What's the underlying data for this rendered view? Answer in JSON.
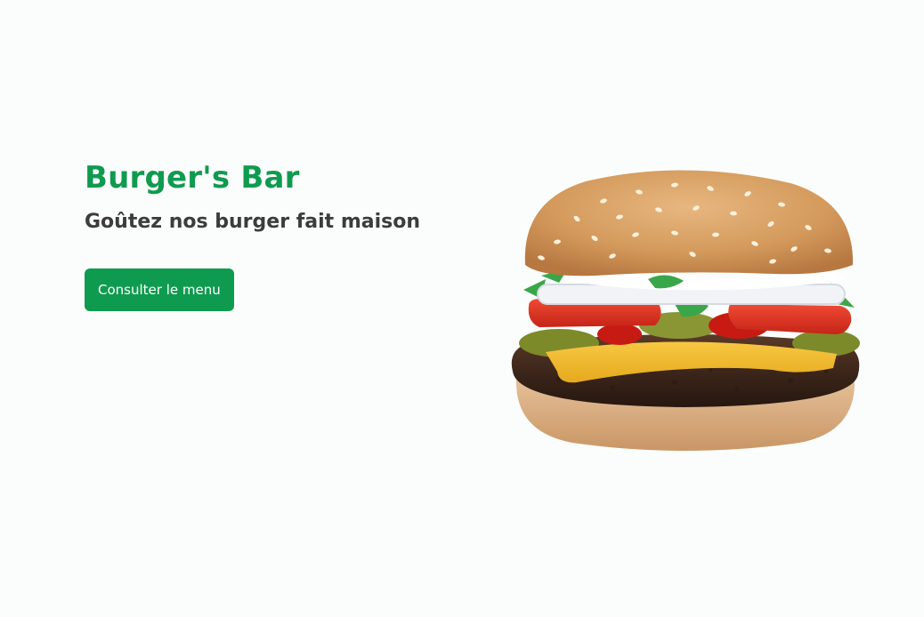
{
  "hero": {
    "title": "Burger's Bar",
    "subtitle": "Goûtez nos burger fait maison",
    "cta_label": "Consulter le menu"
  },
  "image": {
    "subject": "burger-image"
  },
  "colors": {
    "accent": "#0f9b4f",
    "text_dark": "#3c3c3c",
    "background": "#fbfdfc"
  }
}
